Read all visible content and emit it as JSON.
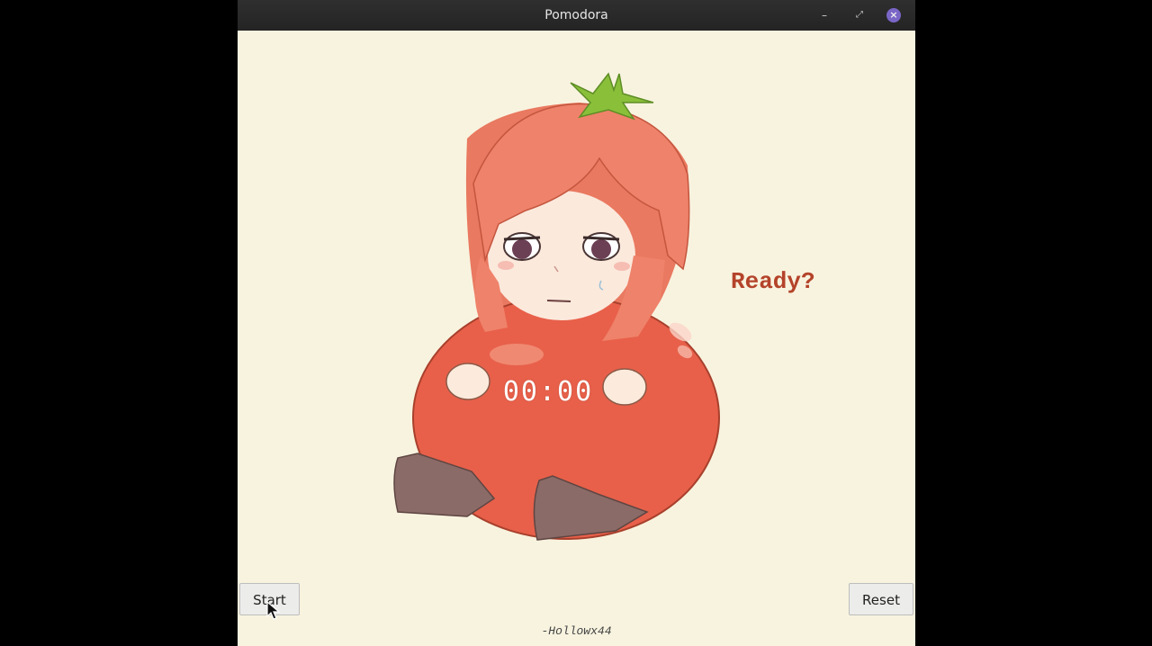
{
  "window": {
    "title": "Pomodora",
    "controls": {
      "minimize": "–",
      "maximize": "⤢",
      "close": "×"
    }
  },
  "main": {
    "timer": "00:00",
    "status": "Ready?",
    "credit": "-Hollowx44"
  },
  "buttons": {
    "start": "Start",
    "reset": "Reset"
  },
  "colors": {
    "background": "#f8f3df",
    "tomato": "#e8604a",
    "hair": "#ee8468",
    "status_text": "#b4432a",
    "close_button": "#7a66c7"
  },
  "icons": [
    "minimize-icon",
    "maximize-icon",
    "close-icon",
    "mouse-cursor-icon"
  ]
}
